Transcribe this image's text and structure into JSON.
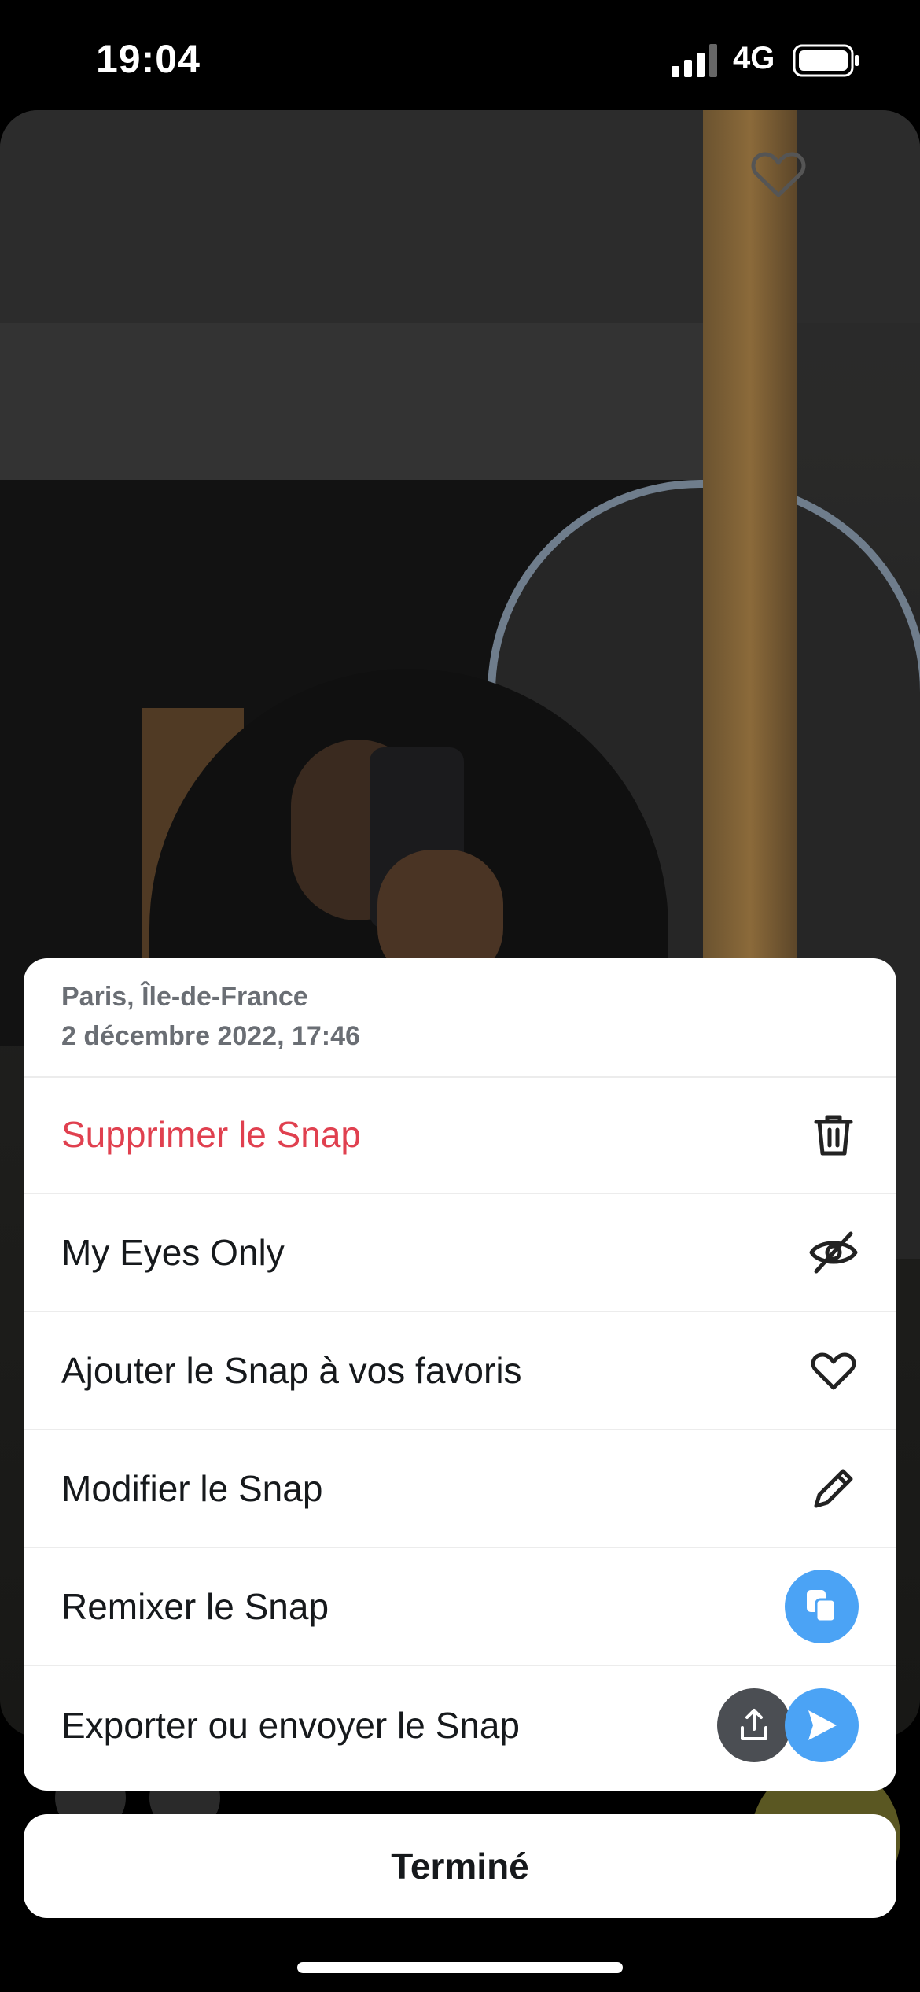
{
  "status_bar": {
    "time": "19:04",
    "network": "4G"
  },
  "snap_info": {
    "location": "Paris, Île-de-France",
    "date": "2 décembre 2022, 17:46"
  },
  "menu": {
    "delete": "Supprimer le Snap",
    "my_eyes_only": "My Eyes Only",
    "favorite": "Ajouter le Snap à vos favoris",
    "edit": "Modifier le Snap",
    "remix": "Remixer le Snap",
    "export": "Exporter ou envoyer le Snap"
  },
  "done_label": "Terminé",
  "colors": {
    "danger": "#e0404f",
    "accent": "#4ba3f5"
  }
}
